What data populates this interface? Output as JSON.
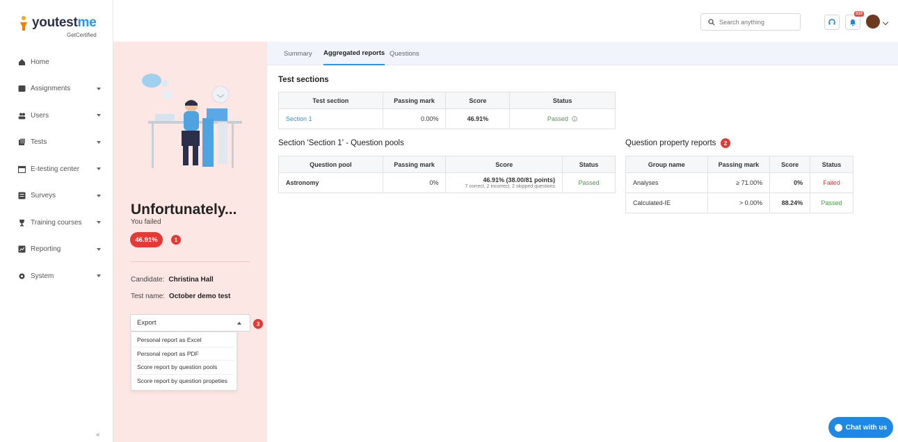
{
  "brand": {
    "name_part1": "youtest",
    "name_part2": "me",
    "tagline": "GetCertified"
  },
  "sidebar": {
    "items": [
      {
        "label": "Home",
        "icon": "home-icon",
        "has_children": false
      },
      {
        "label": "Assignments",
        "icon": "assignments-icon",
        "has_children": true
      },
      {
        "label": "Users",
        "icon": "users-icon",
        "has_children": true
      },
      {
        "label": "Tests",
        "icon": "tests-icon",
        "has_children": true
      },
      {
        "label": "E-testing center",
        "icon": "calendar-icon",
        "has_children": true
      },
      {
        "label": "Surveys",
        "icon": "surveys-icon",
        "has_children": true
      },
      {
        "label": "Training courses",
        "icon": "trophy-icon",
        "has_children": true
      },
      {
        "label": "Reporting",
        "icon": "reporting-icon",
        "has_children": true
      },
      {
        "label": "System",
        "icon": "gear-icon",
        "has_children": true
      }
    ],
    "collapse_label": "«"
  },
  "topbar": {
    "search_placeholder": "Search anything",
    "notification_count": "310"
  },
  "result": {
    "headline": "Unfortunately...",
    "status_text": "You failed",
    "score": "46.91%",
    "candidate_label": "Candidate:",
    "candidate_value": "Christina Hall",
    "test_name_label": "Test name:",
    "test_name_value": "October demo test",
    "export_label": "Export",
    "export_options": [
      "Personal report as Excel",
      "Personal report as PDF",
      "Score report by question pools",
      "Score report by question propeties"
    ],
    "markers": [
      "1",
      "2",
      "3"
    ]
  },
  "tabs": [
    {
      "label": "Summary",
      "active": false
    },
    {
      "label": "Aggregated reports",
      "active": true
    },
    {
      "label": "Questions",
      "active": false
    }
  ],
  "test_sections": {
    "title": "Test sections",
    "headers": [
      "Test section",
      "Passing mark",
      "Score",
      "Status"
    ],
    "rows": [
      {
        "section": "Section 1",
        "passing_mark": "0.00%",
        "score": "46.91%",
        "status": "Passed"
      }
    ]
  },
  "question_pools": {
    "title": "Section 'Section 1' - Question pools",
    "headers": [
      "Question pool",
      "Passing mark",
      "Score",
      "Status"
    ],
    "rows": [
      {
        "pool": "Astronomy",
        "passing_mark": "0%",
        "score": "46.91% (38.00/81 points)",
        "score_detail": "7 correct, 2 incorrect, 2 skipped questions",
        "status": "Passed"
      }
    ]
  },
  "property_reports": {
    "title": "Question property reports",
    "headers": [
      "Group name",
      "Passing mark",
      "Score",
      "Status"
    ],
    "rows": [
      {
        "group": "Analyses",
        "passing_mark": "≥ 71.00%",
        "score": "0%",
        "status": "Failed"
      },
      {
        "group": "Calculated-IE",
        "passing_mark": "> 0.00%",
        "score": "88.24%",
        "status": "Passed"
      }
    ]
  },
  "chat": {
    "label": "Chat with us"
  },
  "colors": {
    "accent": "#2196f3",
    "fail": "#e53935",
    "pass": "#43a047",
    "panel_bg": "#fde7e4"
  }
}
